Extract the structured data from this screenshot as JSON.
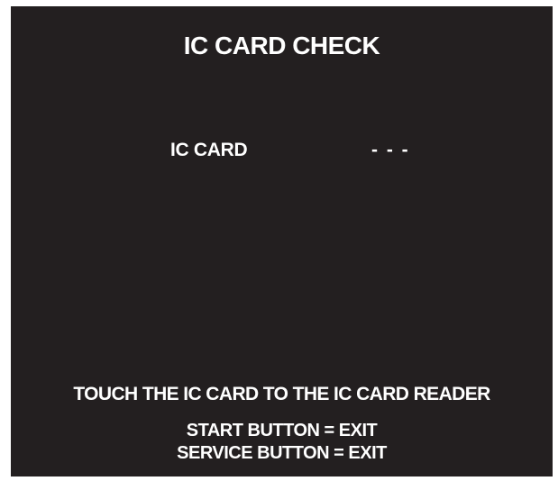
{
  "screen": {
    "title": "IC CARD CHECK",
    "status_row": {
      "label": "IC CARD",
      "value": "- - -"
    },
    "instruction": "TOUCH THE IC CARD TO THE IC CARD READER",
    "controls": [
      "START BUTTON = EXIT",
      "SERVICE BUTTON = EXIT"
    ],
    "colors": {
      "background": "#231f20",
      "text": "#ffffff"
    }
  }
}
